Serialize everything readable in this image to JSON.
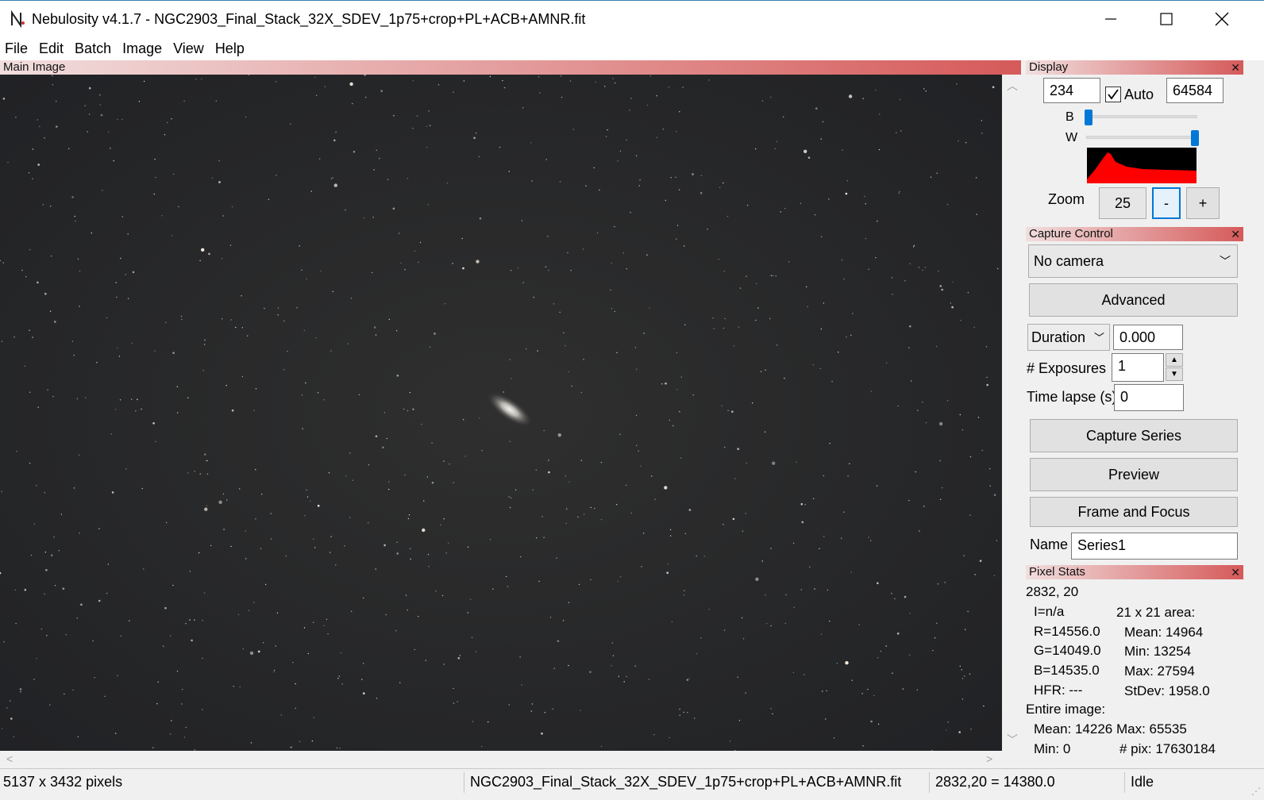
{
  "window": {
    "title": "Nebulosity v4.1.7 - NGC2903_Final_Stack_32X_SDEV_1p75+crop+PL+ACB+AMNR.fit"
  },
  "menu": [
    "File",
    "Edit",
    "Batch",
    "Image",
    "View",
    "Help"
  ],
  "main_image": {
    "title": "Main Image"
  },
  "display": {
    "title": "Display",
    "black_value": "234",
    "auto_label": "Auto",
    "auto_checked": true,
    "white_value": "64584",
    "b_label": "B",
    "w_label": "W",
    "b_slider_level": 0.02,
    "w_slider_level": 0.98,
    "zoom_label": "Zoom",
    "zoom_value": "25",
    "zoom_minus": "-",
    "zoom_plus": "+"
  },
  "capture": {
    "title": "Capture Control",
    "camera": "No camera",
    "advanced": "Advanced",
    "duration_label": "Duration",
    "duration_value": "0.000",
    "exposures_label": "# Exposures",
    "exposures_value": "1",
    "timelapse_label": "Time lapse (s)",
    "timelapse_value": "0",
    "capture_series": "Capture Series",
    "preview": "Preview",
    "frame_focus": "Frame and Focus",
    "name_label": "Name",
    "name_value": "Series1"
  },
  "pixel_stats": {
    "title": "Pixel Stats",
    "coords": "2832, 20",
    "i": "I=n/a",
    "r": "R=14556.0",
    "g": "G=14049.0",
    "b": "B=14535.0",
    "hfr": "HFR: ---",
    "area_label": "21 x 21 area:",
    "mean": "Mean: 14964",
    "min": "Min: 13254",
    "max": "Max: 27594",
    "stdev": "StDev: 1958.0",
    "entire_label": "Entire image:",
    "entire_mean": "Mean: 14226",
    "entire_max": "Max: 65535",
    "entire_min": "Min: 0",
    "entire_pix": "# pix: 17630184"
  },
  "status": {
    "size": "5137 x 3432 pixels",
    "file": "NGC2903_Final_Stack_32X_SDEV_1p75+crop+PL+ACB+AMNR.fit",
    "pixel": "2832,20 = 14380.0",
    "state": "Idle"
  },
  "colors": {
    "panel_header_start": "#f1dede",
    "panel_header_end": "#d65a5a",
    "histogram": "#ff0000",
    "accent": "#0078d7",
    "image_bg": "#2b2b2b"
  }
}
